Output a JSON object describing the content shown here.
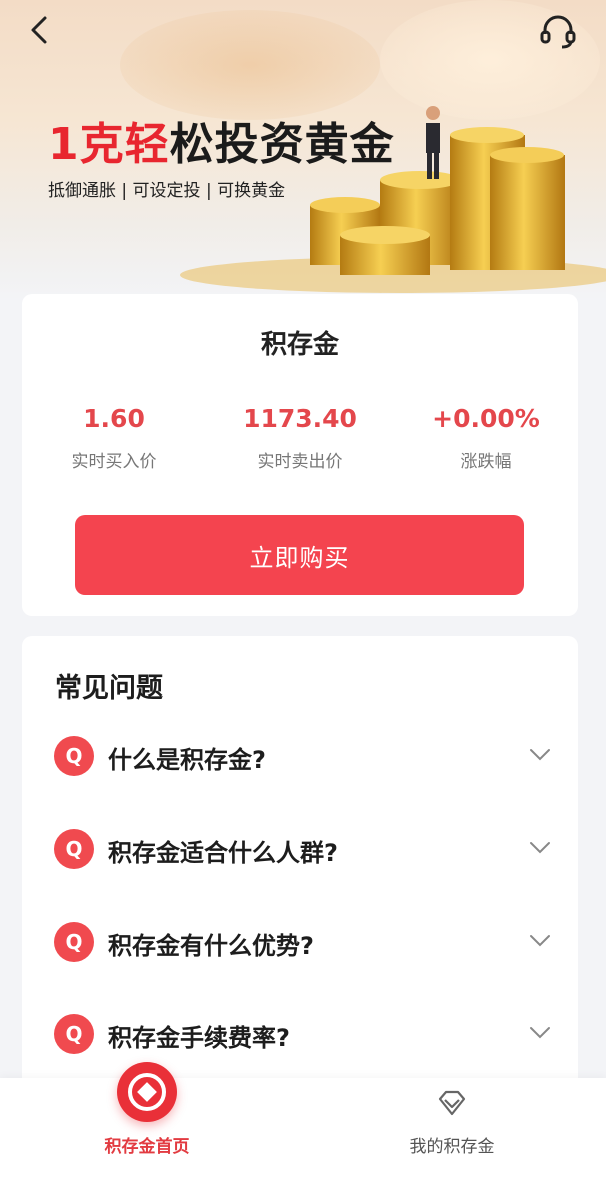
{
  "header": {
    "back_icon": "chevron-left-icon",
    "service_icon": "headset-icon"
  },
  "hero": {
    "title_accent": "1克轻",
    "title_rest": "松投资黄金",
    "subtitle": "抵御通胀 | 可设定投 | 可换黄金"
  },
  "product": {
    "name": "积存金",
    "stats": [
      {
        "value": "1.60",
        "label": "实时买入价"
      },
      {
        "value": "1173.40",
        "label": "实时卖出价"
      },
      {
        "value": "+0.00%",
        "label": "涨跌幅"
      }
    ],
    "buy_label": "立即购买"
  },
  "faq": {
    "title": "常见问题",
    "badge": "Q",
    "items": [
      {
        "question": "什么是积存金?"
      },
      {
        "question": "积存金适合什么人群?"
      },
      {
        "question": "积存金有什么优势?"
      },
      {
        "question": "积存金手续费率?"
      }
    ]
  },
  "tabbar": {
    "tabs": [
      {
        "label": "积存金首页",
        "icon": "home-diamond-icon",
        "active": true
      },
      {
        "label": "我的积存金",
        "icon": "gem-icon",
        "active": false
      }
    ]
  },
  "colors": {
    "accent": "#e8262f",
    "price_red": "#e4474c",
    "button": "#f4444f"
  }
}
